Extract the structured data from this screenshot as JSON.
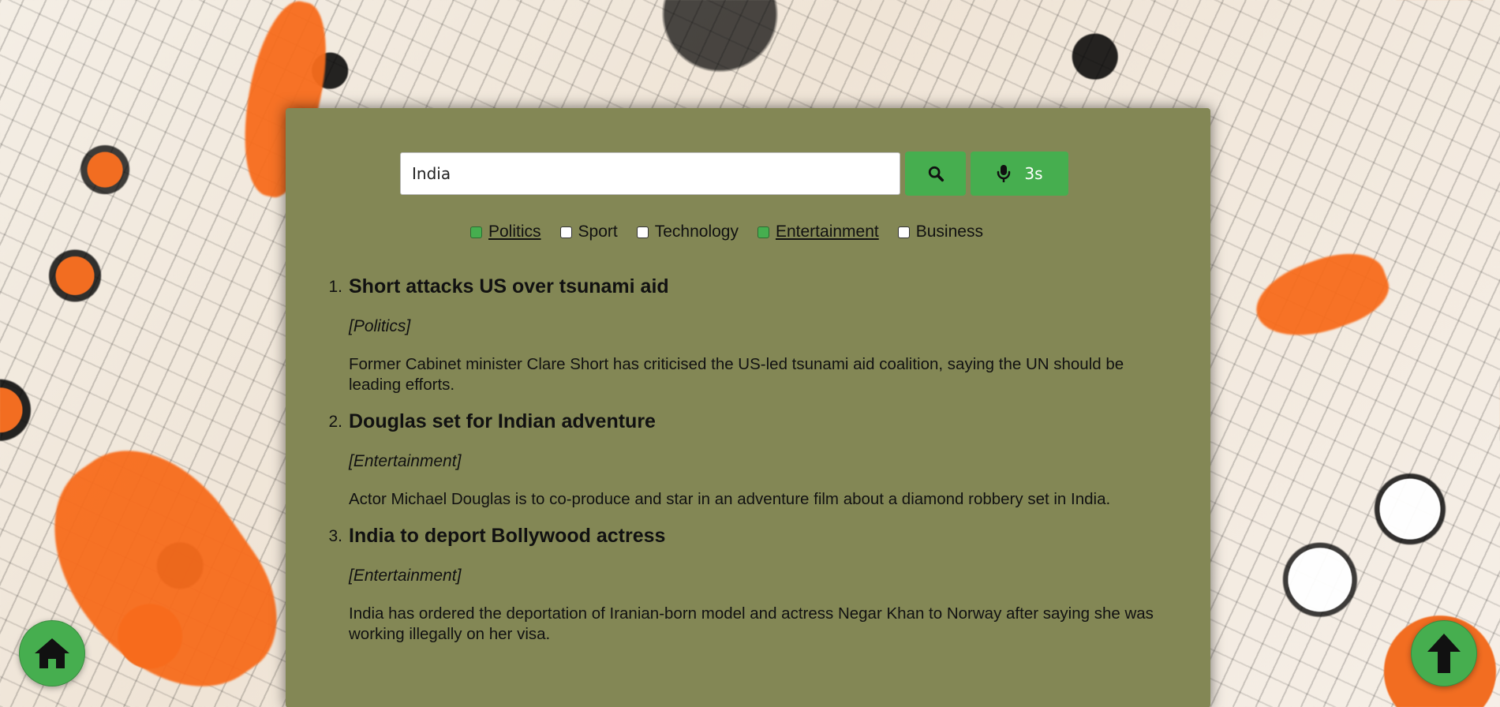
{
  "search": {
    "value": "India",
    "search_button_icon": "search-icon",
    "voice_button_icon": "microphone-icon",
    "voice_duration": "3s"
  },
  "filters": [
    {
      "label": "Politics",
      "checked": true
    },
    {
      "label": "Sport",
      "checked": false
    },
    {
      "label": "Technology",
      "checked": false
    },
    {
      "label": "Entertainment",
      "checked": true
    },
    {
      "label": "Business",
      "checked": false
    }
  ],
  "results": [
    {
      "number": "1.",
      "title": "Short attacks US over tsunami aid",
      "category": "[Politics]",
      "summary": "Former Cabinet minister Clare Short has criticised the US-led tsunami aid coalition, saying the UN should be leading efforts."
    },
    {
      "number": "2.",
      "title": "Douglas set for Indian adventure",
      "category": "[Entertainment]",
      "summary": "Actor Michael Douglas is to co-produce and star in an adventure film about a diamond robbery set in India."
    },
    {
      "number": "3.",
      "title": "India to deport Bollywood actress",
      "category": "[Entertainment]",
      "summary": "India has ordered the deportation of Iranian-born model and actress Negar Khan to Norway after saying she was working illegally on her visa."
    }
  ],
  "floating_buttons": {
    "home_icon": "home-icon",
    "top_icon": "arrow-up-icon"
  },
  "colors": {
    "panel": "#838757",
    "accent": "#4aad52"
  }
}
